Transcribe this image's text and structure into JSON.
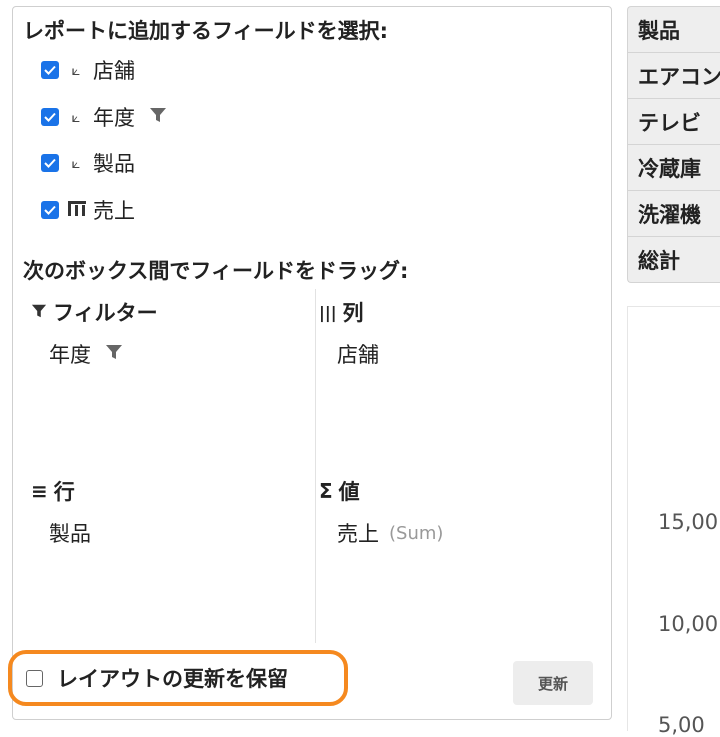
{
  "field_list": {
    "title": "レポートに追加するフィールドを選択:",
    "fields": [
      {
        "label": "店舗",
        "checked": true,
        "type_icon": "dimension-icon"
      },
      {
        "label": "年度",
        "checked": true,
        "type_icon": "dimension-icon",
        "filtered": true
      },
      {
        "label": "製品",
        "checked": true,
        "type_icon": "dimension-icon"
      },
      {
        "label": "売上",
        "checked": true,
        "type_icon": "measure-icon"
      }
    ]
  },
  "drag_area": {
    "title": "次のボックス間でフィールドをドラッグ:",
    "filters": {
      "title": "フィルター",
      "items": [
        "年度"
      ]
    },
    "columns": {
      "title": "列",
      "items": [
        "店舗"
      ]
    },
    "rows": {
      "title": "行",
      "items": [
        "製品"
      ]
    },
    "values": {
      "title": "値",
      "items": [
        {
          "label": "売上",
          "aggregate": "(Sum)"
        }
      ]
    }
  },
  "defer_layout": {
    "label": "レイアウトの更新を保留",
    "checked": false
  },
  "update_button": "更新",
  "pivot_table": {
    "header": "製品",
    "rows": [
      "エアコン",
      "テレビ",
      "冷蔵庫",
      "洗濯機",
      "総計"
    ]
  },
  "chart": {
    "y_ticks": [
      "15,00",
      "10,00",
      "5,00"
    ]
  },
  "colors": {
    "accent": "#1a73e8",
    "highlight": "#f5891f"
  }
}
